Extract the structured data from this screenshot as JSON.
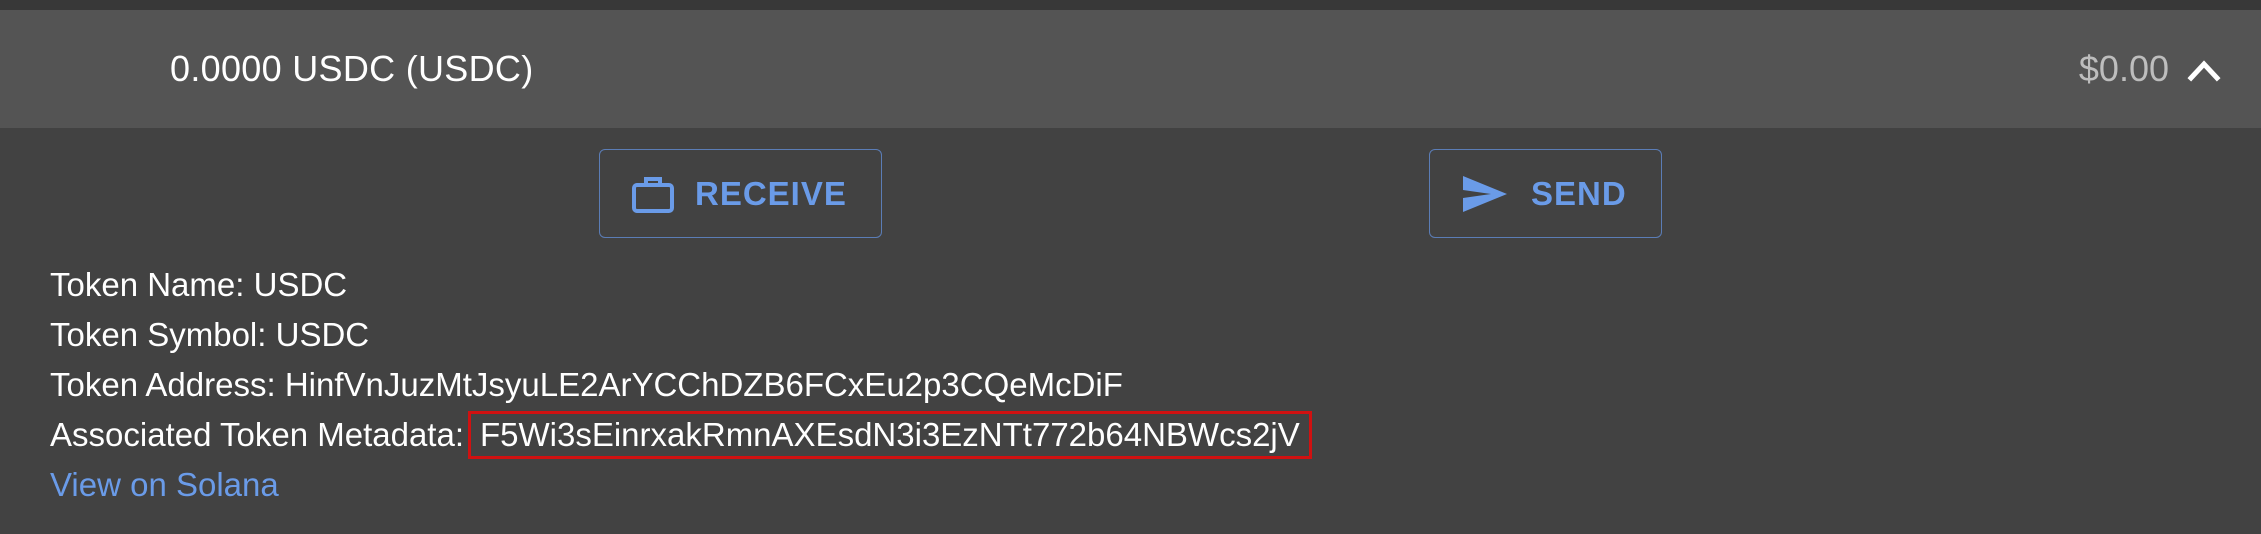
{
  "token": {
    "title": "0.0000 USDC (USDC)",
    "balance": "$0.00"
  },
  "actions": {
    "receive_label": "RECEIVE",
    "send_label": "SEND"
  },
  "details": {
    "name_label": "Token Name:",
    "name_value": "USDC",
    "symbol_label": "Token Symbol:",
    "symbol_value": "USDC",
    "address_label": "Token Address:",
    "address_value": "HinfVnJuzMtJsyuLE2ArYCChDZB6FCxEu2p3CQeMcDiF",
    "metadata_label": "Associated Token Metadata:",
    "metadata_value": "F5Wi3sEinrxakRmnAXEsdN3i3EzNTt772b64NBWcs2jV",
    "view_link": "View on Solana"
  },
  "icons": {
    "chevron": "chevron-up-icon",
    "receive": "briefcase-icon",
    "send": "send-icon"
  },
  "colors": {
    "accent": "#6a9be8",
    "highlight_border": "#d01111",
    "header_bg": "#545454",
    "panel_bg": "#424242"
  }
}
